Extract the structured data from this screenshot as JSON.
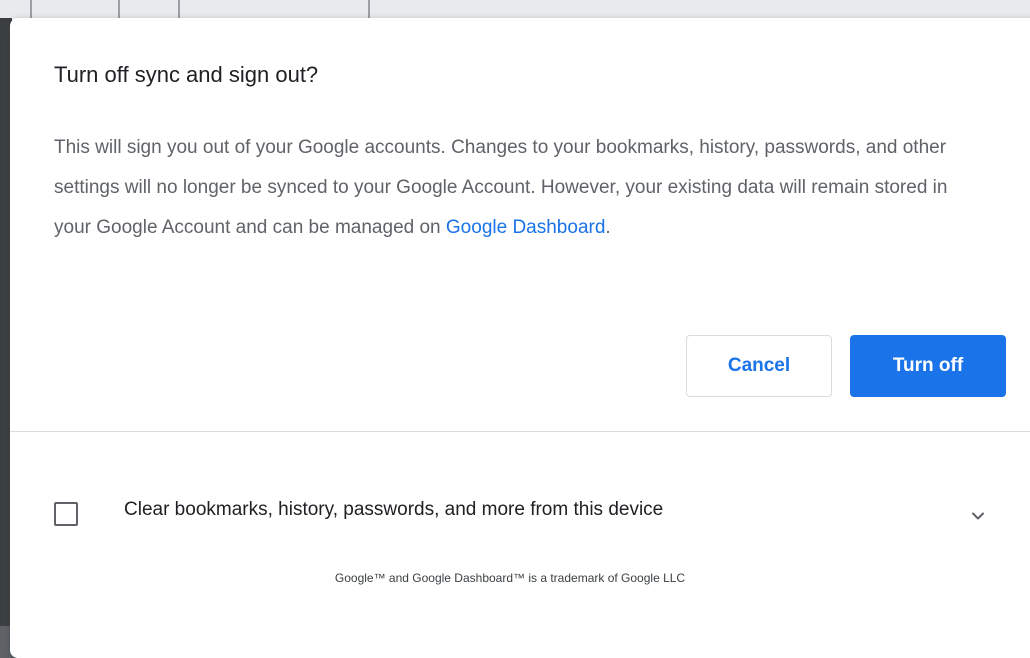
{
  "dialog": {
    "title": "Turn off sync and sign out?",
    "body_text": "This will sign you out of your Google accounts. Changes to your bookmarks, history, passwords, and other settings will no longer be synced to your Google Account. However, your existing data will remain stored in your Google Account and can be managed on ",
    "dashboard_link": "Google Dashboard",
    "body_end": ".",
    "cancel_label": "Cancel",
    "turn_off_label": "Turn off",
    "clear_data_label": "Clear bookmarks, history, passwords, and more from this device",
    "clear_data_checked": false,
    "expand_icon": "chevron-down-icon",
    "trademark_footer": "Google™ and Google Dashboard™ is a trademark of Google LLC"
  },
  "colors": {
    "accent": "#1a73e8",
    "title": "#202124",
    "body": "#5f6368",
    "divider": "#dadce0"
  }
}
